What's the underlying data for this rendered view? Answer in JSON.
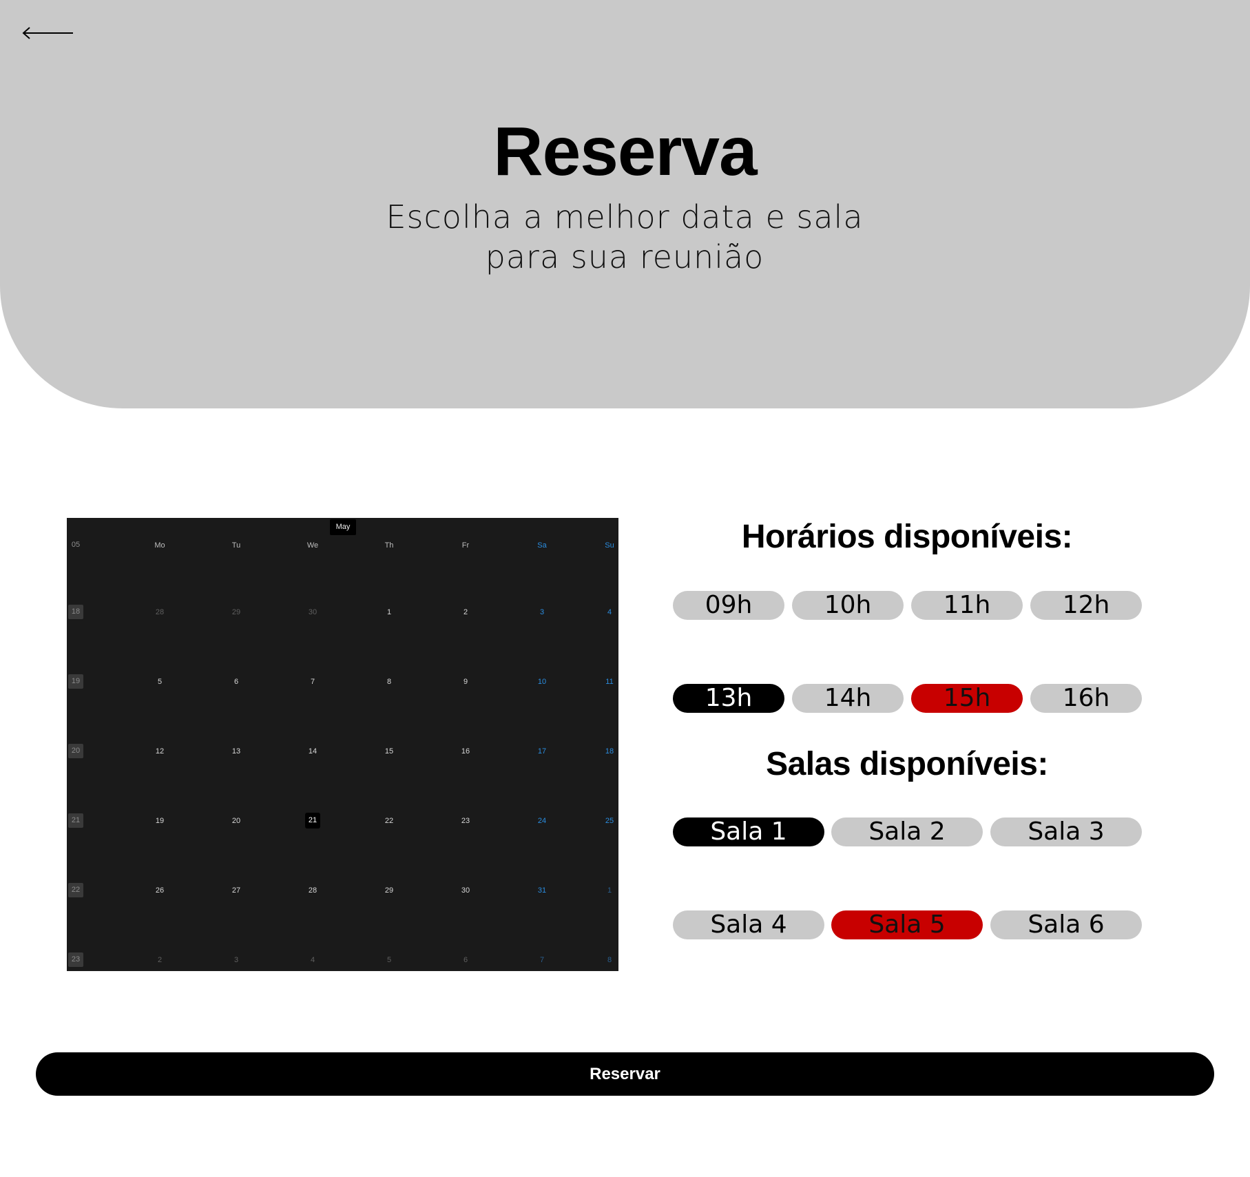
{
  "header": {
    "back_icon": "arrow-left-icon",
    "title": "Reserva",
    "subtitle_line1": "Escolha a melhor data e sala",
    "subtitle_line2": "para sua reunião"
  },
  "calendar": {
    "month": "May",
    "week_header": "05",
    "weekdays": [
      "Mo",
      "Tu",
      "We",
      "Th",
      "Fr",
      "Sa",
      "Su"
    ],
    "selected_day": "21",
    "weeks": [
      {
        "week": "18",
        "days": [
          "28",
          "29",
          "30",
          "1",
          "2",
          "3",
          "4"
        ]
      },
      {
        "week": "19",
        "days": [
          "5",
          "6",
          "7",
          "8",
          "9",
          "10",
          "11"
        ]
      },
      {
        "week": "20",
        "days": [
          "12",
          "13",
          "14",
          "15",
          "16",
          "17",
          "18"
        ]
      },
      {
        "week": "21",
        "days": [
          "19",
          "20",
          "21",
          "22",
          "23",
          "24",
          "25"
        ]
      },
      {
        "week": "22",
        "days": [
          "26",
          "27",
          "28",
          "29",
          "30",
          "31",
          "1"
        ]
      },
      {
        "week": "23",
        "days": [
          "2",
          "3",
          "4",
          "5",
          "6",
          "7",
          "8"
        ]
      }
    ],
    "colors": {
      "background": "#1a1a1a",
      "weekend": "#2a8de0"
    }
  },
  "times": {
    "title": "Horários disponíveis:",
    "slots": [
      {
        "label": "09h",
        "state": "available"
      },
      {
        "label": "10h",
        "state": "available"
      },
      {
        "label": "11h",
        "state": "available"
      },
      {
        "label": "12h",
        "state": "available"
      },
      {
        "label": "13h",
        "state": "selected"
      },
      {
        "label": "14h",
        "state": "available"
      },
      {
        "label": "15h",
        "state": "unavailable"
      },
      {
        "label": "16h",
        "state": "available"
      }
    ]
  },
  "rooms": {
    "title": "Salas disponíveis:",
    "items": [
      {
        "label": "Sala 1",
        "state": "selected"
      },
      {
        "label": "Sala 2",
        "state": "available"
      },
      {
        "label": "Sala 3",
        "state": "available"
      },
      {
        "label": "Sala 4",
        "state": "available"
      },
      {
        "label": "Sala 5",
        "state": "unavailable"
      },
      {
        "label": "Sala 6",
        "state": "available"
      }
    ]
  },
  "colors": {
    "available": "#c9c9c9",
    "selected": "#000000",
    "unavailable": "#c80000"
  },
  "actions": {
    "reserve_label": "Reservar"
  }
}
